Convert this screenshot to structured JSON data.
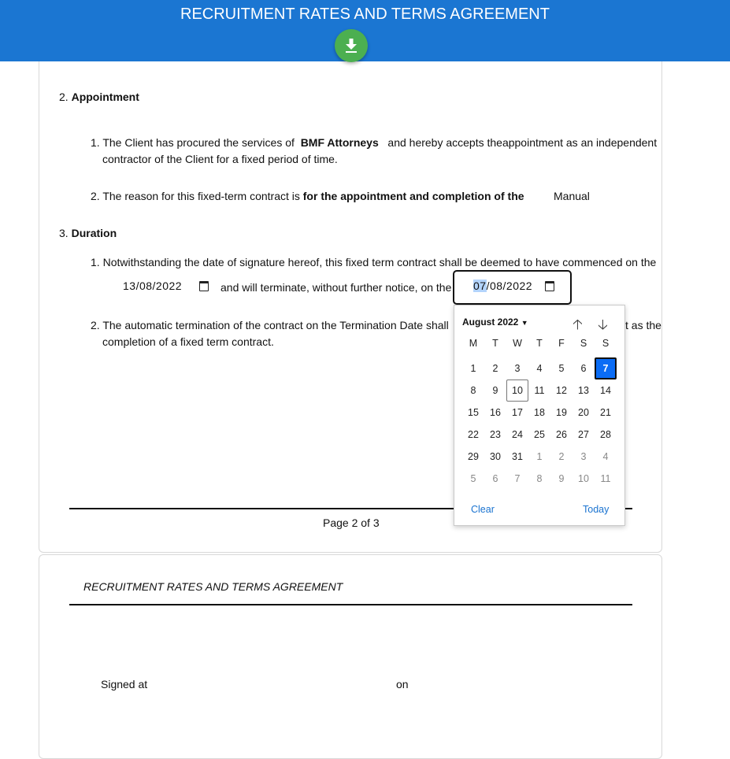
{
  "header": {
    "title": "RECRUITMENT RATES AND TERMS AGREEMENT",
    "download_icon": "download-icon",
    "colors": {
      "bar": "#1b76d2",
      "download_button": "#4caf50"
    }
  },
  "page1": {
    "section2": {
      "number": "2.",
      "heading": "Appointment",
      "item1": {
        "number": "1.",
        "text_before": "The Client has procured the services of",
        "party": "BMF Attorneys",
        "text_after": "and hereby accepts theappointment as an independent",
        "line2": "contractor of the Client for a fixed period of time."
      },
      "item2": {
        "number": "2.",
        "text_before": "The reason for this fixed-term contract is",
        "bold": "for the appointment and completion of the",
        "value": "Manual"
      }
    },
    "section3": {
      "number": "3.",
      "heading": "Duration",
      "item1": {
        "number": "1.",
        "text": "Notwithstanding the date of signature hereof, this fixed term contract shall be deemed to have commenced on the",
        "start_date": "13/08/2022",
        "middle_text": "and will terminate, without further notice, on the",
        "end_date_day": "07",
        "end_date_rest": "/08/2022"
      },
      "item2": {
        "number": "2.",
        "text_before": "The automatic termination of the contract on the Termination Date shall",
        "text_after_visible": "t as the",
        "line2": "completion of a fixed term contract."
      }
    },
    "footer": "Page 2 of 3"
  },
  "date_picker": {
    "month_label": "August 2022",
    "weekdays": [
      "M",
      "T",
      "W",
      "T",
      "F",
      "S",
      "S"
    ],
    "weeks": [
      [
        {
          "d": "1"
        },
        {
          "d": "2"
        },
        {
          "d": "3"
        },
        {
          "d": "4"
        },
        {
          "d": "5"
        },
        {
          "d": "6"
        },
        {
          "d": "7",
          "state": "selected"
        }
      ],
      [
        {
          "d": "8"
        },
        {
          "d": "9"
        },
        {
          "d": "10",
          "state": "today"
        },
        {
          "d": "11"
        },
        {
          "d": "12"
        },
        {
          "d": "13"
        },
        {
          "d": "14"
        }
      ],
      [
        {
          "d": "15"
        },
        {
          "d": "16"
        },
        {
          "d": "17"
        },
        {
          "d": "18"
        },
        {
          "d": "19"
        },
        {
          "d": "20"
        },
        {
          "d": "21"
        }
      ],
      [
        {
          "d": "22"
        },
        {
          "d": "23"
        },
        {
          "d": "24"
        },
        {
          "d": "25"
        },
        {
          "d": "26"
        },
        {
          "d": "27"
        },
        {
          "d": "28"
        }
      ],
      [
        {
          "d": "29"
        },
        {
          "d": "30"
        },
        {
          "d": "31"
        },
        {
          "d": "1",
          "state": "other"
        },
        {
          "d": "2",
          "state": "other"
        },
        {
          "d": "3",
          "state": "other"
        },
        {
          "d": "4",
          "state": "other"
        }
      ],
      [
        {
          "d": "5",
          "state": "other"
        },
        {
          "d": "6",
          "state": "other"
        },
        {
          "d": "7",
          "state": "other"
        },
        {
          "d": "8",
          "state": "other"
        },
        {
          "d": "9",
          "state": "other"
        },
        {
          "d": "10",
          "state": "other"
        },
        {
          "d": "11",
          "state": "other"
        }
      ]
    ],
    "clear_label": "Clear",
    "today_label": "Today",
    "prev_icon": "arrow-up-icon",
    "next_icon": "arrow-down-icon",
    "colors": {
      "selected": "#0a6cf5",
      "link": "#1a73d0"
    }
  },
  "page2": {
    "running_header": "RECRUITMENT RATES AND TERMS AGREEMENT",
    "signed_at_label": "Signed at",
    "on_label": "on"
  }
}
